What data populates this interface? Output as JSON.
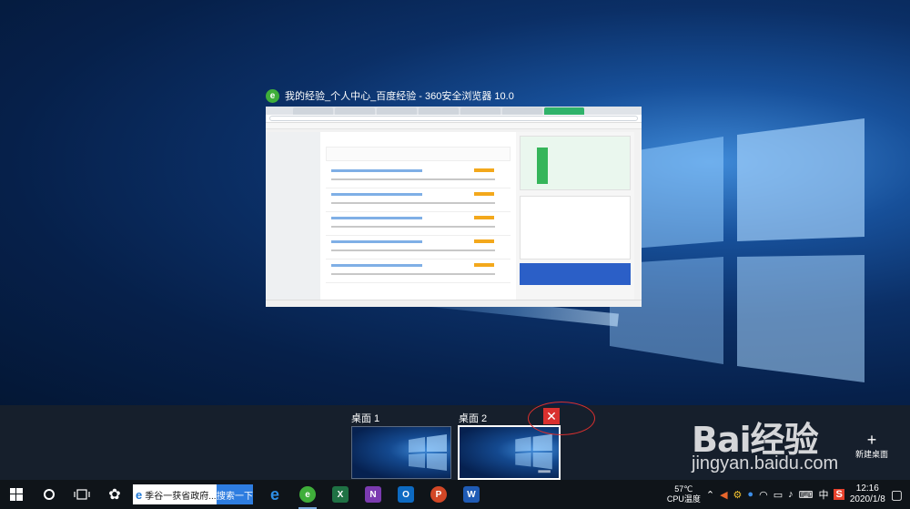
{
  "task_view": {
    "window_title": "我的经验_个人中心_百度经验 - 360安全浏览器 10.0"
  },
  "virtual_desktops": [
    {
      "label": "桌面 1",
      "selected": false
    },
    {
      "label": "桌面 2",
      "selected": true
    }
  ],
  "new_desktop": {
    "label": "新建桌面",
    "icon": "plus-icon"
  },
  "watermark": {
    "logo": "Bai经验",
    "url": "jingyan.baidu.com"
  },
  "taskbar": {
    "search_text": "季谷一获省政府...",
    "search_button": "搜索一下",
    "apps": [
      {
        "name": "edge",
        "icon": "e"
      },
      {
        "name": "360-browser",
        "icon": "e"
      },
      {
        "name": "excel",
        "icon": "X"
      },
      {
        "name": "onenote",
        "icon": "N"
      },
      {
        "name": "outlook",
        "icon": "O"
      },
      {
        "name": "powerpoint",
        "icon": "P"
      },
      {
        "name": "word",
        "icon": "W"
      }
    ],
    "temperature": "57℃",
    "temperature_label": "CPU温度",
    "ime": "中",
    "time": "12:16",
    "date": "2020/1/8"
  },
  "colors": {
    "taskbar": "#0f1419",
    "accent_close": "#d9302f",
    "search_button": "#2e7de0"
  }
}
